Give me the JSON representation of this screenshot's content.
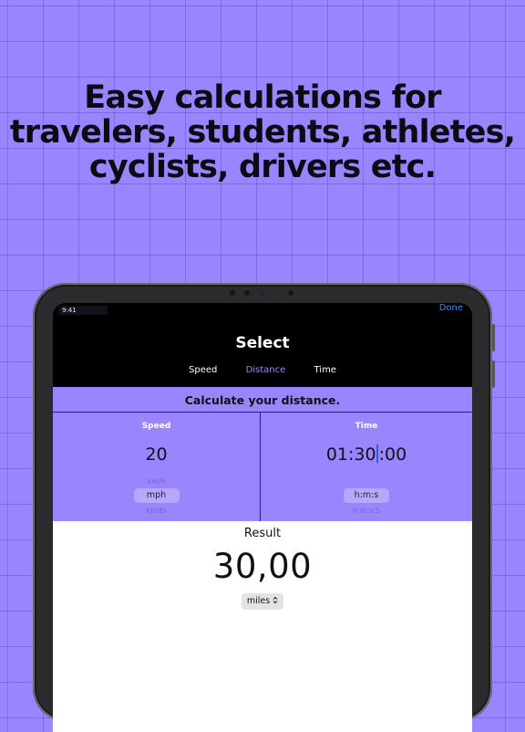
{
  "headline": {
    "line1": "Easy calculations for",
    "line2": "travelers, students, athletes,",
    "line3": "cyclists, drivers etc."
  },
  "status_bar": {
    "time": "9:41"
  },
  "nav": {
    "done_label": "Done",
    "title": "Select",
    "tabs": [
      "Speed",
      "Distance",
      "Time"
    ],
    "active_tab": "Distance"
  },
  "calc_title": "Calculate your distance.",
  "speed": {
    "label": "Speed",
    "value": "20",
    "unit_above": "km/h",
    "unit_selected": "mph",
    "unit_below": "knots"
  },
  "time": {
    "label": "Time",
    "value_before_cursor": "01:30",
    "value_after_cursor": ":00",
    "unit_selected": "h:m:s",
    "unit_below": "h:m:s.S"
  },
  "result": {
    "label": "Result",
    "value": "30,00",
    "unit": "miles",
    "unit_icon": "up-down-chevron-icon"
  },
  "colors": {
    "accent": "#9a85ff",
    "link": "#3d8bff",
    "background": "#9a85ff"
  }
}
